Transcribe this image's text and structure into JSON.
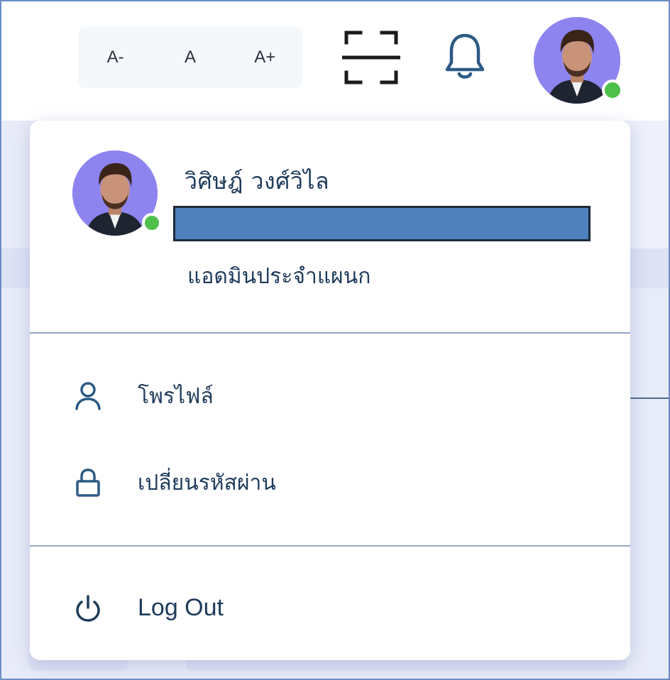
{
  "header": {
    "font_size": {
      "decrease_label": "A-",
      "reset_label": "A",
      "increase_label": "A+"
    },
    "icons": {
      "scan": "scan-frame-icon",
      "notifications": "bell-icon",
      "avatar": "user-avatar"
    },
    "avatar_status": "online"
  },
  "user_menu": {
    "name": "วิศิษฎ์ วงศ์วิไล",
    "role": "แอดมินประจำแผนก",
    "status": "online",
    "items": [
      {
        "label": "โพรไฟล์",
        "icon": "user-icon"
      },
      {
        "label": "เปลี่ยนรหัสผ่าน",
        "icon": "lock-icon"
      }
    ],
    "logout": {
      "label": "Log Out",
      "icon": "power-icon"
    }
  },
  "colors": {
    "text": "#1f3b5c",
    "status_online": "#4ec04a",
    "avatar_bg": "#8e84f0",
    "redaction": "#4f81bd",
    "divider": "#90a8c8"
  }
}
